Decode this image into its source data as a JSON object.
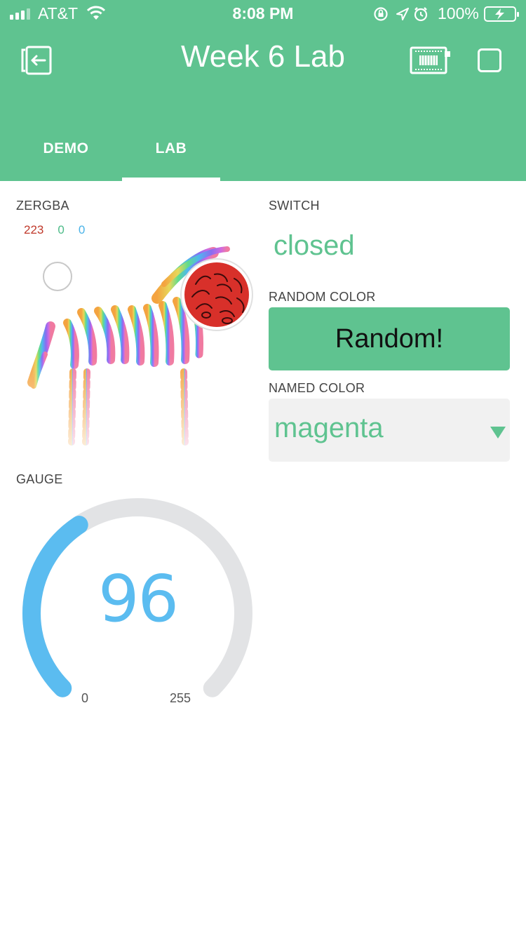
{
  "status_bar": {
    "carrier": "AT&T",
    "time": "8:08 PM",
    "battery_percent": "100%",
    "signal_bars_filled": 3,
    "signal_bars_total": 4
  },
  "header": {
    "title": "Week 6 Lab",
    "background_color": "#5fc390",
    "tabs": [
      {
        "label": "DEMO",
        "selected": false
      },
      {
        "label": "LAB",
        "selected": true
      }
    ]
  },
  "widgets": {
    "zergba": {
      "label": "ZERGBA",
      "r": "223",
      "g": "0",
      "b": "0",
      "selected_color": "#d8302a"
    },
    "switch": {
      "label": "SWITCH",
      "value": "closed"
    },
    "random_color": {
      "label": "RANDOM COLOR",
      "button_label": "Random!"
    },
    "named_color": {
      "label": "NAMED COLOR",
      "value": "magenta"
    },
    "gauge": {
      "label": "GAUGE",
      "value": "96",
      "min": "0",
      "max": "255",
      "fill_fraction": 0.376,
      "color": "#5bbcf0"
    }
  }
}
